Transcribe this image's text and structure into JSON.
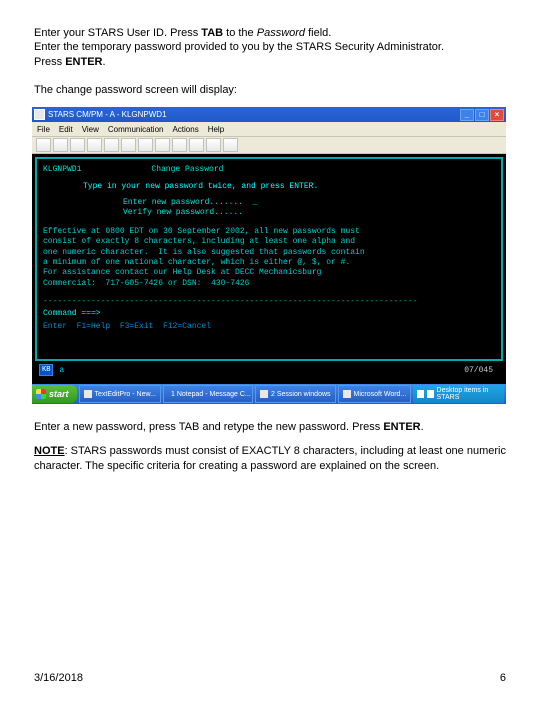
{
  "intro": {
    "line1_pre": "Enter your STARS User ID.  Press ",
    "tab": "TAB",
    "line1_mid": " to the ",
    "password_word": "Password",
    "line1_post": " field.",
    "line2": "Enter the temporary password provided to you by the STARS Security Administrator.",
    "line3_pre": "Press ",
    "enter": "ENTER",
    "line3_post": "."
  },
  "lead": "The change password screen will display:",
  "window": {
    "title": "STARS CM/PM - A - KLGNPWD1",
    "menu": [
      "File",
      "Edit",
      "View",
      "Communication",
      "Actions",
      "Help"
    ],
    "btn_min": "_",
    "btn_max": "□",
    "btn_close": "×"
  },
  "terminal": {
    "id": "KLGNPWD1",
    "title": "Change Password",
    "instruction": "Type in your new password twice, and press ENTER.",
    "field1": "Enter new password.......  _",
    "field2": "Verify new password......",
    "policy": "Effective at 0800 EDT on 30 September 2002, all new passwords must\nconsist of exactly 8 characters, including at least one alpha and\none numeric character.  It is also suggested that passwords contain\na minimum of one national character, which is either @, $, or #.\nFor assistance contact our Help Desk at DECC Mechanicsburg\nCommercial:  717-605-7426 or DSN:  430-7426",
    "sep": "------------------------------------------------------------------------------",
    "command": "Command ===>",
    "fkeys": "Enter  F1=Help  F3=Exit  F12=Cancel",
    "status_kbd": "KB",
    "status_a": "a",
    "status_pos": "07/045"
  },
  "taskbar": {
    "start": "start",
    "items": [
      "TextEditPro - New...",
      "1 Notepad - Message C...",
      "2 Session windows",
      "Microsoft Word..."
    ],
    "tray_text": "Desktop items in STARS"
  },
  "after": {
    "p1_pre": "Enter a new password, press TAB and retype the new password.  Press ",
    "p1_enter": "ENTER",
    "p1_post": ".",
    "note_label": "NOTE",
    "note_body": ":  STARS passwords must consist of EXACTLY 8 characters, including at least one numeric character.  The specific criteria for creating a password are explained on the screen."
  },
  "footer": {
    "date": "3/16/2018",
    "page": "6"
  }
}
